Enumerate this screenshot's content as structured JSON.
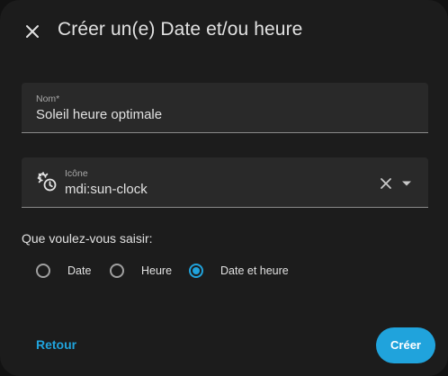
{
  "dialog": {
    "title": "Créer un(e) Date et/ou heure",
    "close_icon": "close-icon"
  },
  "name_field": {
    "label": "Nom*",
    "value": "Soleil heure optimale"
  },
  "icon_field": {
    "label": "Icône",
    "value": "mdi:sun-clock",
    "leading_icon": "sun-clock-icon",
    "clear_icon": "close-icon",
    "dropdown_icon": "chevron-down-icon"
  },
  "mode": {
    "question": "Que voulez-vous saisir:",
    "options": [
      {
        "label": "Date",
        "checked": false
      },
      {
        "label": "Heure",
        "checked": false
      },
      {
        "label": "Date et heure",
        "checked": true
      }
    ]
  },
  "actions": {
    "back_label": "Retour",
    "create_label": "Créer"
  },
  "colors": {
    "accent": "#20a3dc",
    "surface": "#1c1c1c",
    "field": "#292929"
  }
}
